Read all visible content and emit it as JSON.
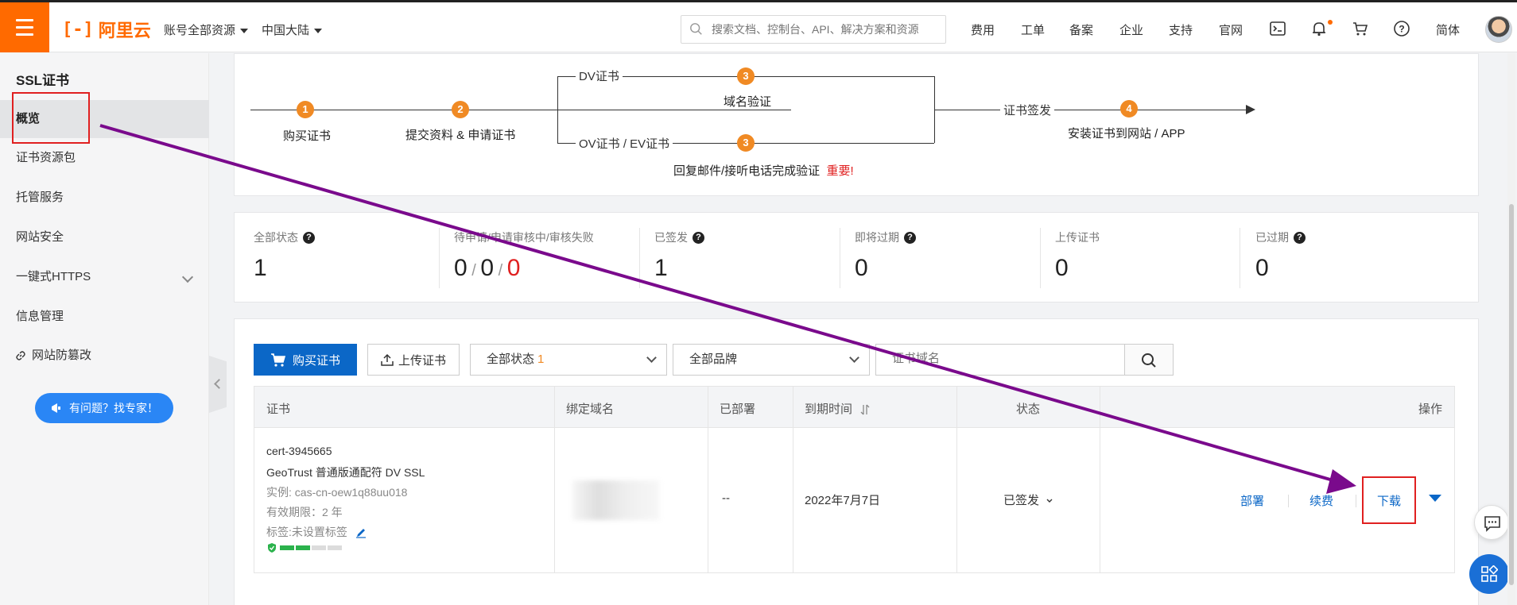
{
  "topbar": {
    "logo_text": "阿里云",
    "account_dropdown": "账号全部资源",
    "region_dropdown": "中国大陆",
    "search_placeholder": "搜索文档、控制台、API、解决方案和资源",
    "links": [
      "费用",
      "工单",
      "备案",
      "企业",
      "支持",
      "官网"
    ],
    "lang": "简体",
    "icons": [
      "terminal-icon",
      "bell-icon",
      "cart-icon",
      "help-icon"
    ]
  },
  "sidebar": {
    "title": "SSL证书",
    "items": [
      {
        "label": "概览",
        "active": true
      },
      {
        "label": "证书资源包"
      },
      {
        "label": "托管服务"
      },
      {
        "label": "网站安全"
      },
      {
        "label": "一键式HTTPS",
        "expandable": true
      },
      {
        "label": "信息管理"
      },
      {
        "label": "网站防篡改",
        "icon": "link-icon"
      }
    ],
    "help_button": "有问题？找专家！"
  },
  "flow": {
    "steps": [
      {
        "num": "1",
        "label": "购买证书"
      },
      {
        "num": "2",
        "label": "提交资料 & 申请证书"
      },
      {
        "num": "3",
        "label": "域名验证"
      },
      {
        "num": "4",
        "label": "安装证书到网站 / APP"
      }
    ],
    "dv_label": "DV证书",
    "ov_label": "OV证书 / EV证书",
    "issue_label": "证书签发",
    "verify_note": "回复邮件/接听电话完成验证",
    "important": "重要!"
  },
  "stats": [
    {
      "label": "全部状态",
      "value": "1",
      "help": true
    },
    {
      "label": "待申请/申请审核中/审核失败",
      "values": [
        "0",
        "0",
        "0"
      ]
    },
    {
      "label": "已签发",
      "value": "1",
      "help": true
    },
    {
      "label": "即将过期",
      "value": "0",
      "help": true,
      "red": true
    },
    {
      "label": "上传证书",
      "value": "0"
    },
    {
      "label": "已过期",
      "value": "0",
      "help": true,
      "red": true
    }
  ],
  "toolbar": {
    "buy_button": "购买证书",
    "upload_button": "上传证书",
    "status_select": "全部状态",
    "status_count": "1",
    "brand_select": "全部品牌",
    "domain_placeholder": "证书域名"
  },
  "table": {
    "headers": [
      "证书",
      "绑定域名",
      "已部署",
      "到期时间",
      "状态",
      "操作"
    ],
    "rows": [
      {
        "cert_id": "cert-3945665",
        "cert_type": "GeoTrust 普通版通配符 DV SSL",
        "instance": "实例: cas-cn-oew1q88uu018",
        "validity": "有效期限：2 年",
        "tag": "标签:未设置标签",
        "deployed": "--",
        "expire": "2022年7月7日",
        "status": "已签发",
        "actions": [
          "部署",
          "续费",
          "下载"
        ],
        "strength": 0.5
      }
    ]
  },
  "colors": {
    "brand_orange": "#ff6a00",
    "primary_blue": "#0b67c7",
    "annotation_red": "#e02020",
    "annotation_arrow": "#7a0a8c"
  }
}
